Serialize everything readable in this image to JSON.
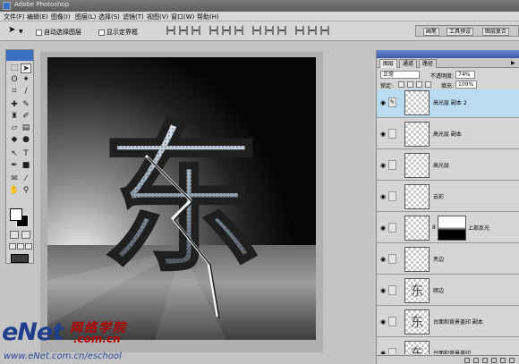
{
  "app": {
    "title": "Adobe Photoshop"
  },
  "menu": [
    "文件(F)",
    "编辑(E)",
    "图像(I)",
    "图层(L)",
    "选择(S)",
    "滤镜(T)",
    "视图(V)",
    "窗口(W)",
    "帮助(H)"
  ],
  "options_bar": {
    "auto_select_layer": "自动选择图层",
    "show_bounding_box": "显示定界框",
    "dock_tabs": [
      "画笔",
      "工具预设",
      "图层复合"
    ]
  },
  "toolbox": {
    "tools": [
      "marquee-tool",
      "move-tool",
      "lasso-tool",
      "magic-wand-tool",
      "crop-tool",
      "slice-tool",
      "healing-brush-tool",
      "brush-tool",
      "clone-stamp-tool",
      "history-brush-tool",
      "eraser-tool",
      "gradient-tool",
      "blur-tool",
      "dodge-tool",
      "path-selection-tool",
      "type-tool",
      "pen-tool",
      "shape-tool",
      "notes-tool",
      "eyedropper-tool",
      "hand-tool",
      "zoom-tool"
    ],
    "foreground": "#ffffff",
    "background": "#000000"
  },
  "canvas": {
    "glyph": "东"
  },
  "layers_panel": {
    "tabs": [
      "图层",
      "通道",
      "路径"
    ],
    "active_tab": "图层",
    "blend_mode": "正常",
    "opacity_label": "不透明度:",
    "opacity": "74%",
    "lock_label": "锁定:",
    "fill_label": "填充:",
    "fill": "100%",
    "layers": [
      {
        "name": "高光层 副本 2",
        "selected": true,
        "linked": true,
        "thumb": ""
      },
      {
        "name": "高光层 副本",
        "selected": false,
        "linked": false,
        "thumb": ""
      },
      {
        "name": "高光层",
        "selected": false,
        "linked": false,
        "thumb": ""
      },
      {
        "name": "云彩",
        "selected": false,
        "linked": false,
        "thumb": ""
      },
      {
        "name": "上部反光",
        "selected": false,
        "linked": false,
        "thumb": "",
        "mask": true
      },
      {
        "name": "亮边",
        "selected": false,
        "linked": false,
        "thumb": ""
      },
      {
        "name": "暗边",
        "selected": false,
        "linked": false,
        "thumb": "东"
      },
      {
        "name": "台面和背景盖印 副本",
        "selected": false,
        "linked": false,
        "thumb": "东"
      },
      {
        "name": "台面和背景盖印",
        "selected": false,
        "linked": false,
        "thumb": "东"
      }
    ]
  },
  "watermark": {
    "logo_enet": "eNet",
    "logo_cn": "网络学院",
    "logo_domain": ".com.cn",
    "url": "www.eNet.com.cn/eschool"
  }
}
